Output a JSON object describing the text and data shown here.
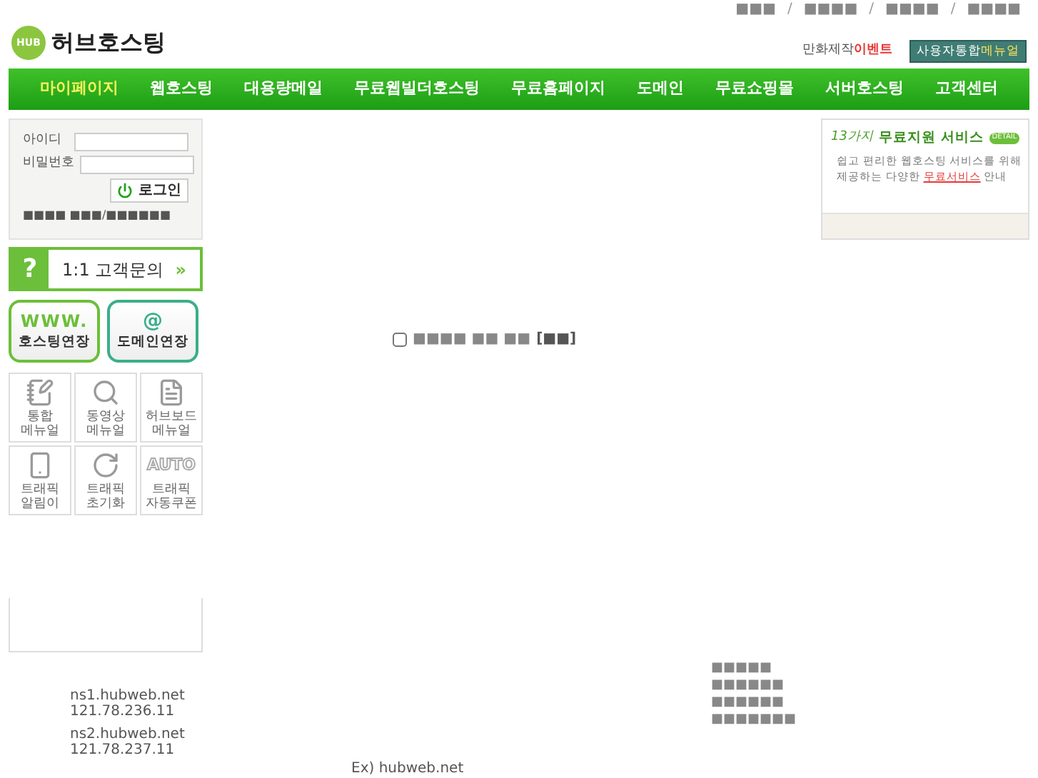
{
  "top_links": [
    "■■■",
    "■■■■",
    "■■■■",
    "■■■■"
  ],
  "separator": "/",
  "logo": {
    "badge": "HUB",
    "name": "허브호스팅"
  },
  "event": {
    "text": "만화제작",
    "highlight": "이벤트"
  },
  "manual_button": {
    "text": "사용자통합",
    "highlight": "메뉴얼"
  },
  "nav": [
    {
      "label": "마이페이지",
      "selected": true
    },
    {
      "label": "웹호스팅",
      "selected": false
    },
    {
      "label": "대용량메일",
      "selected": false
    },
    {
      "label": "무료웹빌더호스팅",
      "selected": false
    },
    {
      "label": "무료홈페이지",
      "selected": false
    },
    {
      "label": "도메인",
      "selected": false
    },
    {
      "label": "무료쇼핑몰",
      "selected": false
    },
    {
      "label": "서버호스팅",
      "selected": false
    },
    {
      "label": "고객센터",
      "selected": false
    }
  ],
  "login": {
    "id_label": "아이디",
    "pw_label": "비밀번호",
    "button": "로그인",
    "links": [
      "■■■■ ■■■",
      "■■■■■■"
    ]
  },
  "inquiry": {
    "mark": "?",
    "label": "1:1 고객문의",
    "arrow": "»"
  },
  "renewals": [
    {
      "kind": "www",
      "top": "WWW.",
      "label": "호스팅연장"
    },
    {
      "kind": "at",
      "top": "@",
      "label": "도메인연장"
    }
  ],
  "tools": [
    {
      "kind": "book",
      "label": "통합\n메뉴얼"
    },
    {
      "kind": "search",
      "label": "동영상\n메뉴얼"
    },
    {
      "kind": "doc",
      "label": "허브보드\n메뉴얼"
    },
    {
      "kind": "phone",
      "label": "트래픽\n알림이"
    },
    {
      "kind": "reset",
      "label": "트래픽\n초기화"
    },
    {
      "kind": "auto",
      "icon_text": "AUTO",
      "label": "트래픽\n자동쿠폰"
    }
  ],
  "free_services": {
    "count": "13가지",
    "title": "무료지원 서비스",
    "badge": "DETAIL",
    "line1": "쉽고 편리한 웹호스팅 서비스를 위해",
    "line2_prefix": "제공하는 다양한",
    "line2_link": "무료서비스",
    "line2_suffix": "안내"
  },
  "notice": {
    "checked": false,
    "text": "■■■■ ■■ ■■",
    "close": "[■■]"
  },
  "nameservers": [
    {
      "host": "ns1.hubweb.net",
      "ip": "121.78.236.11"
    },
    {
      "host": "ns2.hubweb.net",
      "ip": "121.78.237.11"
    }
  ],
  "example": "Ex) hubweb.net",
  "placeholder_lines": [
    "■■■■■",
    "■■■■■■",
    "■■■■■■",
    "■■■■■■■"
  ]
}
